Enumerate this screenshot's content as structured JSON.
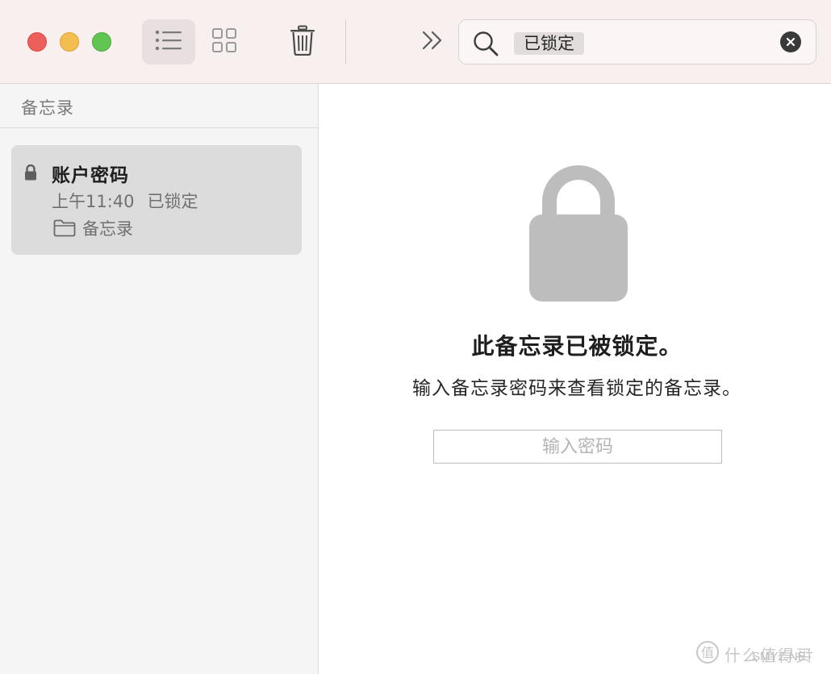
{
  "toolbar": {
    "list_view": "list-icon",
    "gallery_view": "grid-icon",
    "delete": "trash-icon",
    "more": "chevron-double-right-icon",
    "search": {
      "token": "已锁定",
      "search_icon": "search-icon",
      "clear_icon": "clear-icon"
    }
  },
  "sidebar": {
    "title": "备忘录",
    "notes": [
      {
        "title": "账户密码",
        "time": "上午11:40",
        "status": "已锁定",
        "folder": "备忘录"
      }
    ]
  },
  "main": {
    "locked_title": "此备忘录已被锁定。",
    "locked_subtitle": "输入备忘录密码来查看锁定的备忘录。",
    "password_placeholder": "输入密码"
  },
  "watermark": {
    "text": "什么值得买",
    "sub": "SMYZ.NET"
  },
  "colors": {
    "toolbar_bg": "#f8efef",
    "sidebar_bg": "#f5f5f5",
    "selected_note_bg": "#dcdcdc",
    "lock_gray": "#bdbdbd",
    "close": "#ec5f5a",
    "minimize": "#f4bd4f",
    "maximize": "#61c554"
  }
}
